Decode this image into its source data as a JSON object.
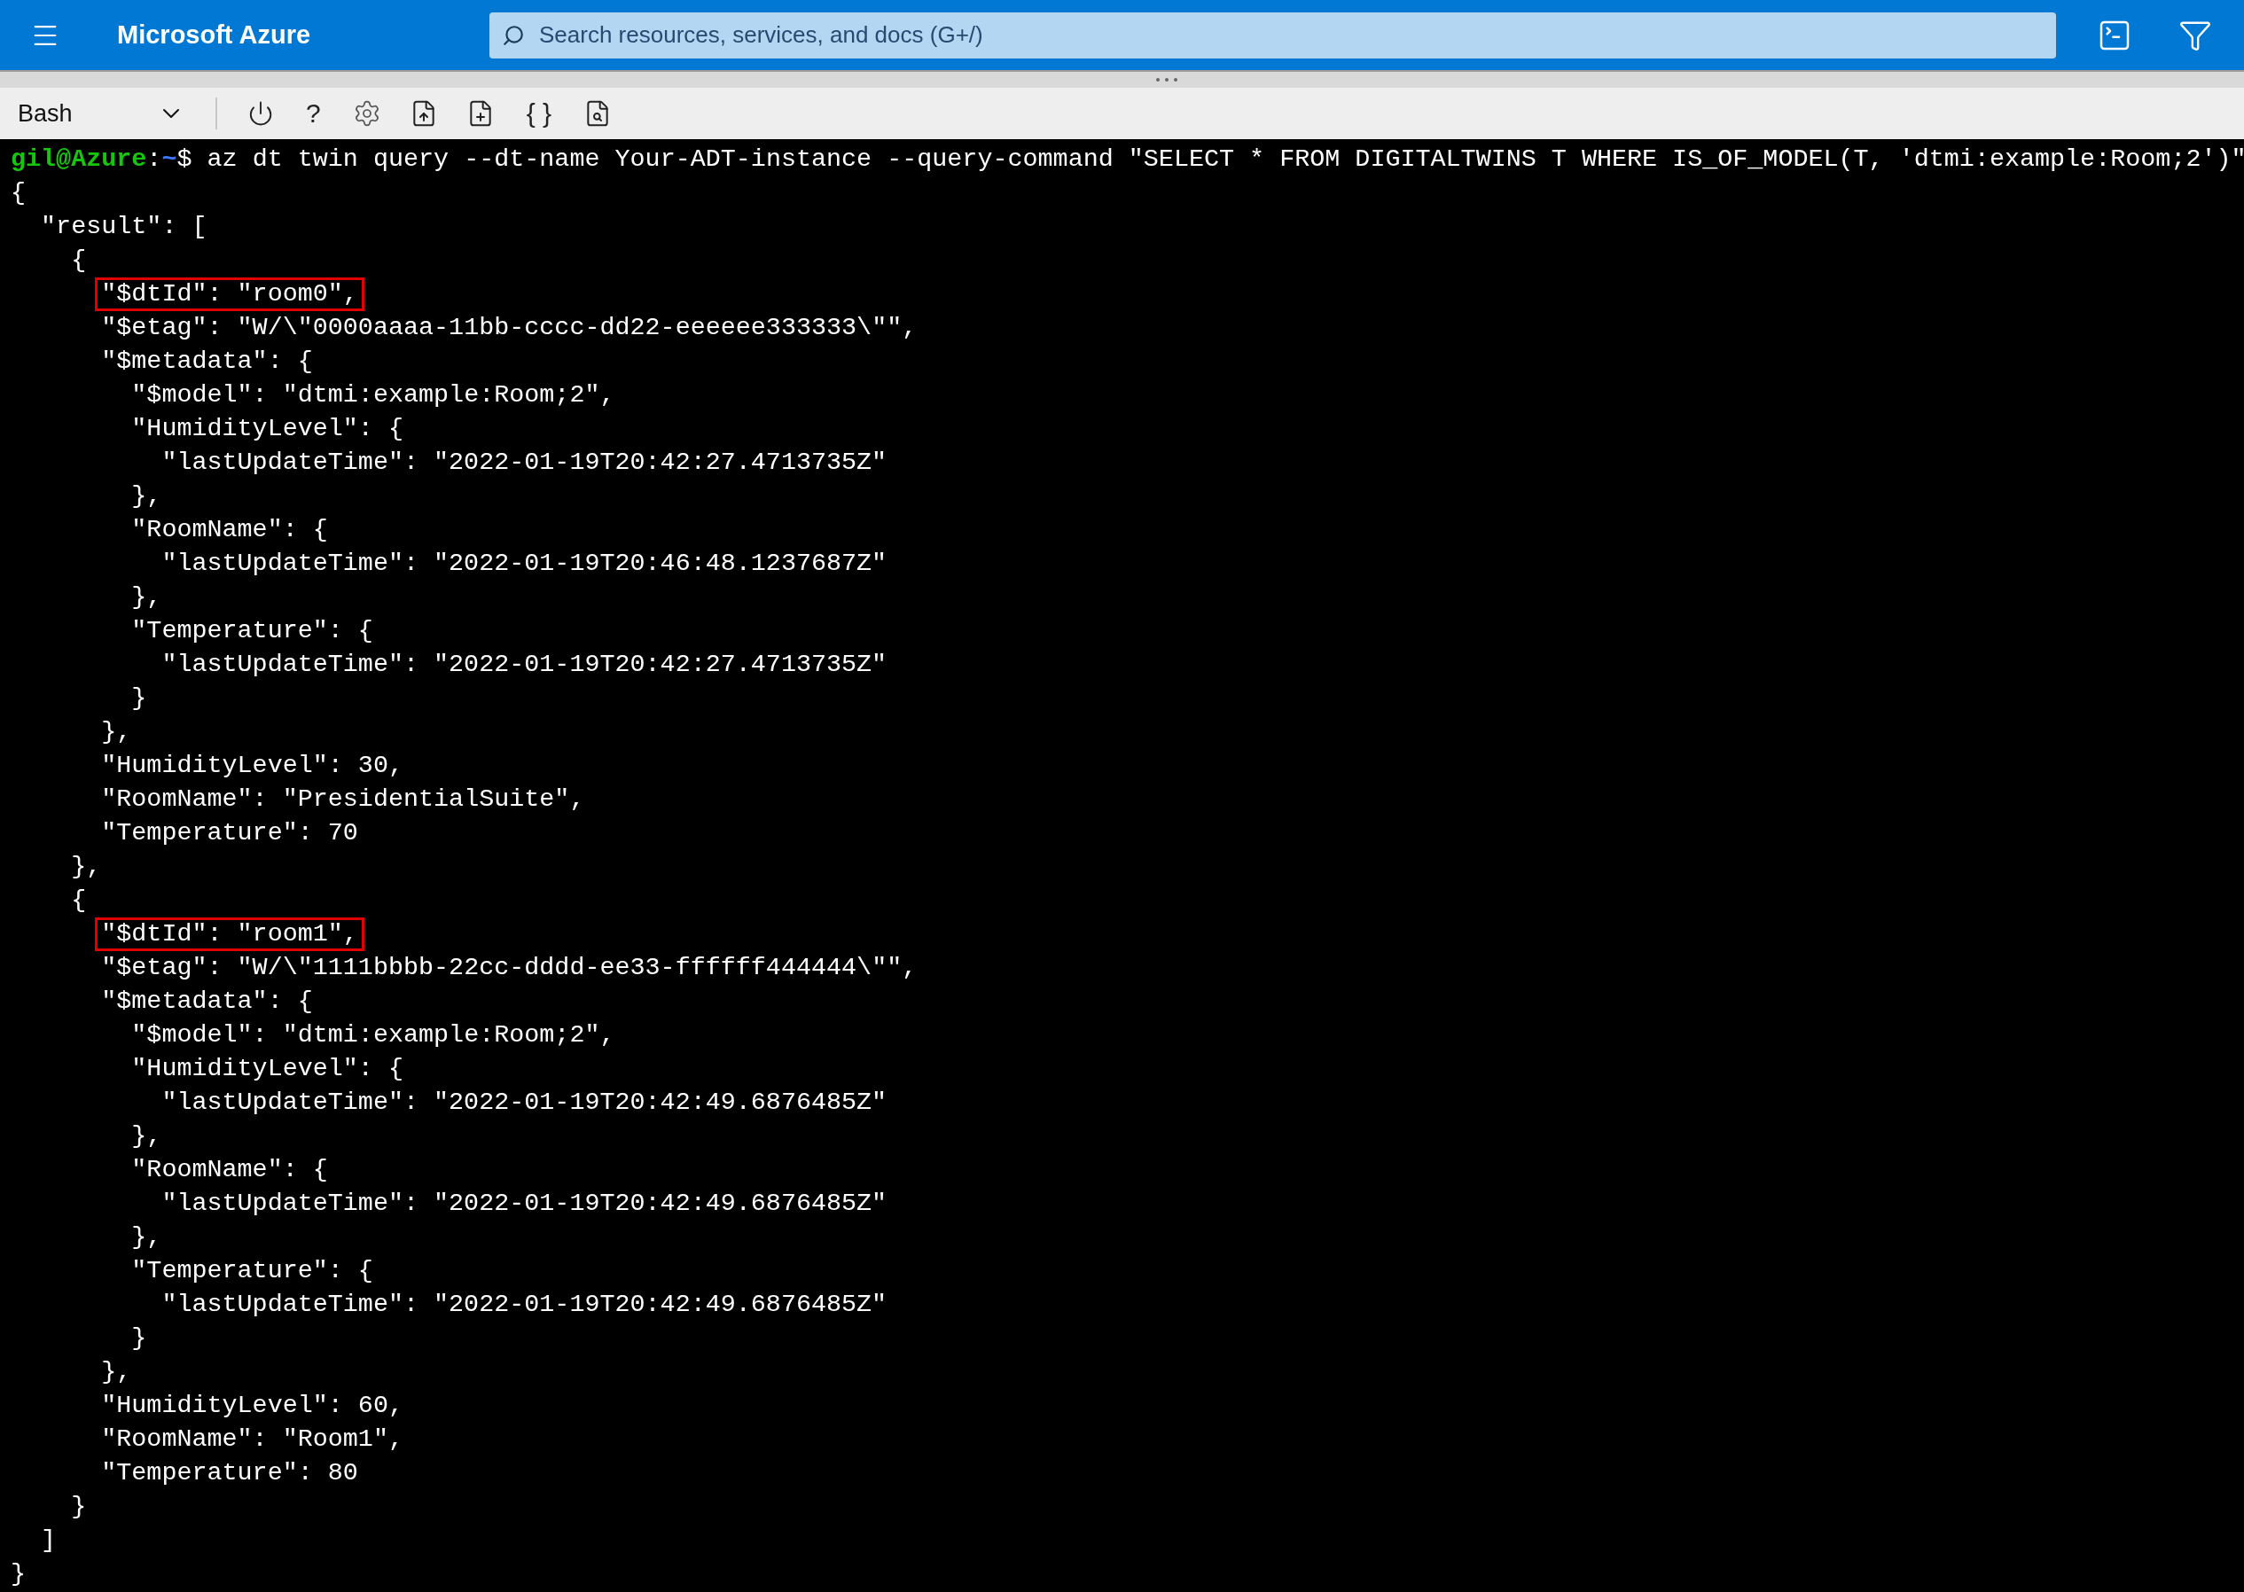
{
  "header": {
    "brand": "Microsoft Azure",
    "search": {
      "placeholder": "Search resources, services, and docs (G+/)"
    }
  },
  "toolbar": {
    "shell": "Bash",
    "help": "?",
    "editor": "{ }"
  },
  "terminal": {
    "prompt": {
      "user": "gil@Azure",
      "sep": ":",
      "dir": "~",
      "symbol": "$ "
    },
    "command": "az dt twin query --dt-name Your-ADT-instance --query-command \"SELECT * FROM DIGITALTWINS T WHERE IS_OF_MODEL(T, 'dtmi:example:Room;2')\"",
    "lines": [
      {
        "text": "{",
        "highlighted": false
      },
      {
        "text": "  \"result\": [",
        "highlighted": false
      },
      {
        "text": "    {",
        "highlighted": false
      },
      {
        "text": "      \"$dtId\": \"room0\",",
        "highlighted": true
      },
      {
        "text": "      \"$etag\": \"W/\\\"0000aaaa-11bb-cccc-dd22-eeeeee333333\\\"\",",
        "highlighted": false
      },
      {
        "text": "      \"$metadata\": {",
        "highlighted": false
      },
      {
        "text": "        \"$model\": \"dtmi:example:Room;2\",",
        "highlighted": false
      },
      {
        "text": "        \"HumidityLevel\": {",
        "highlighted": false
      },
      {
        "text": "          \"lastUpdateTime\": \"2022-01-19T20:42:27.4713735Z\"",
        "highlighted": false
      },
      {
        "text": "        },",
        "highlighted": false
      },
      {
        "text": "        \"RoomName\": {",
        "highlighted": false
      },
      {
        "text": "          \"lastUpdateTime\": \"2022-01-19T20:46:48.1237687Z\"",
        "highlighted": false
      },
      {
        "text": "        },",
        "highlighted": false
      },
      {
        "text": "        \"Temperature\": {",
        "highlighted": false
      },
      {
        "text": "          \"lastUpdateTime\": \"2022-01-19T20:42:27.4713735Z\"",
        "highlighted": false
      },
      {
        "text": "        }",
        "highlighted": false
      },
      {
        "text": "      },",
        "highlighted": false
      },
      {
        "text": "      \"HumidityLevel\": 30,",
        "highlighted": false
      },
      {
        "text": "      \"RoomName\": \"PresidentialSuite\",",
        "highlighted": false
      },
      {
        "text": "      \"Temperature\": 70",
        "highlighted": false
      },
      {
        "text": "    },",
        "highlighted": false
      },
      {
        "text": "    {",
        "highlighted": false
      },
      {
        "text": "      \"$dtId\": \"room1\",",
        "highlighted": true
      },
      {
        "text": "      \"$etag\": \"W/\\\"1111bbbb-22cc-dddd-ee33-ffffff444444\\\"\",",
        "highlighted": false
      },
      {
        "text": "      \"$metadata\": {",
        "highlighted": false
      },
      {
        "text": "        \"$model\": \"dtmi:example:Room;2\",",
        "highlighted": false
      },
      {
        "text": "        \"HumidityLevel\": {",
        "highlighted": false
      },
      {
        "text": "          \"lastUpdateTime\": \"2022-01-19T20:42:49.6876485Z\"",
        "highlighted": false
      },
      {
        "text": "        },",
        "highlighted": false
      },
      {
        "text": "        \"RoomName\": {",
        "highlighted": false
      },
      {
        "text": "          \"lastUpdateTime\": \"2022-01-19T20:42:49.6876485Z\"",
        "highlighted": false
      },
      {
        "text": "        },",
        "highlighted": false
      },
      {
        "text": "        \"Temperature\": {",
        "highlighted": false
      },
      {
        "text": "          \"lastUpdateTime\": \"2022-01-19T20:42:49.6876485Z\"",
        "highlighted": false
      },
      {
        "text": "        }",
        "highlighted": false
      },
      {
        "text": "      },",
        "highlighted": false
      },
      {
        "text": "      \"HumidityLevel\": 60,",
        "highlighted": false
      },
      {
        "text": "      \"RoomName\": \"Room1\",",
        "highlighted": false
      },
      {
        "text": "      \"Temperature\": 80",
        "highlighted": false
      },
      {
        "text": "    }",
        "highlighted": false
      },
      {
        "text": "  ]",
        "highlighted": false
      },
      {
        "text": "}",
        "highlighted": false
      }
    ]
  }
}
